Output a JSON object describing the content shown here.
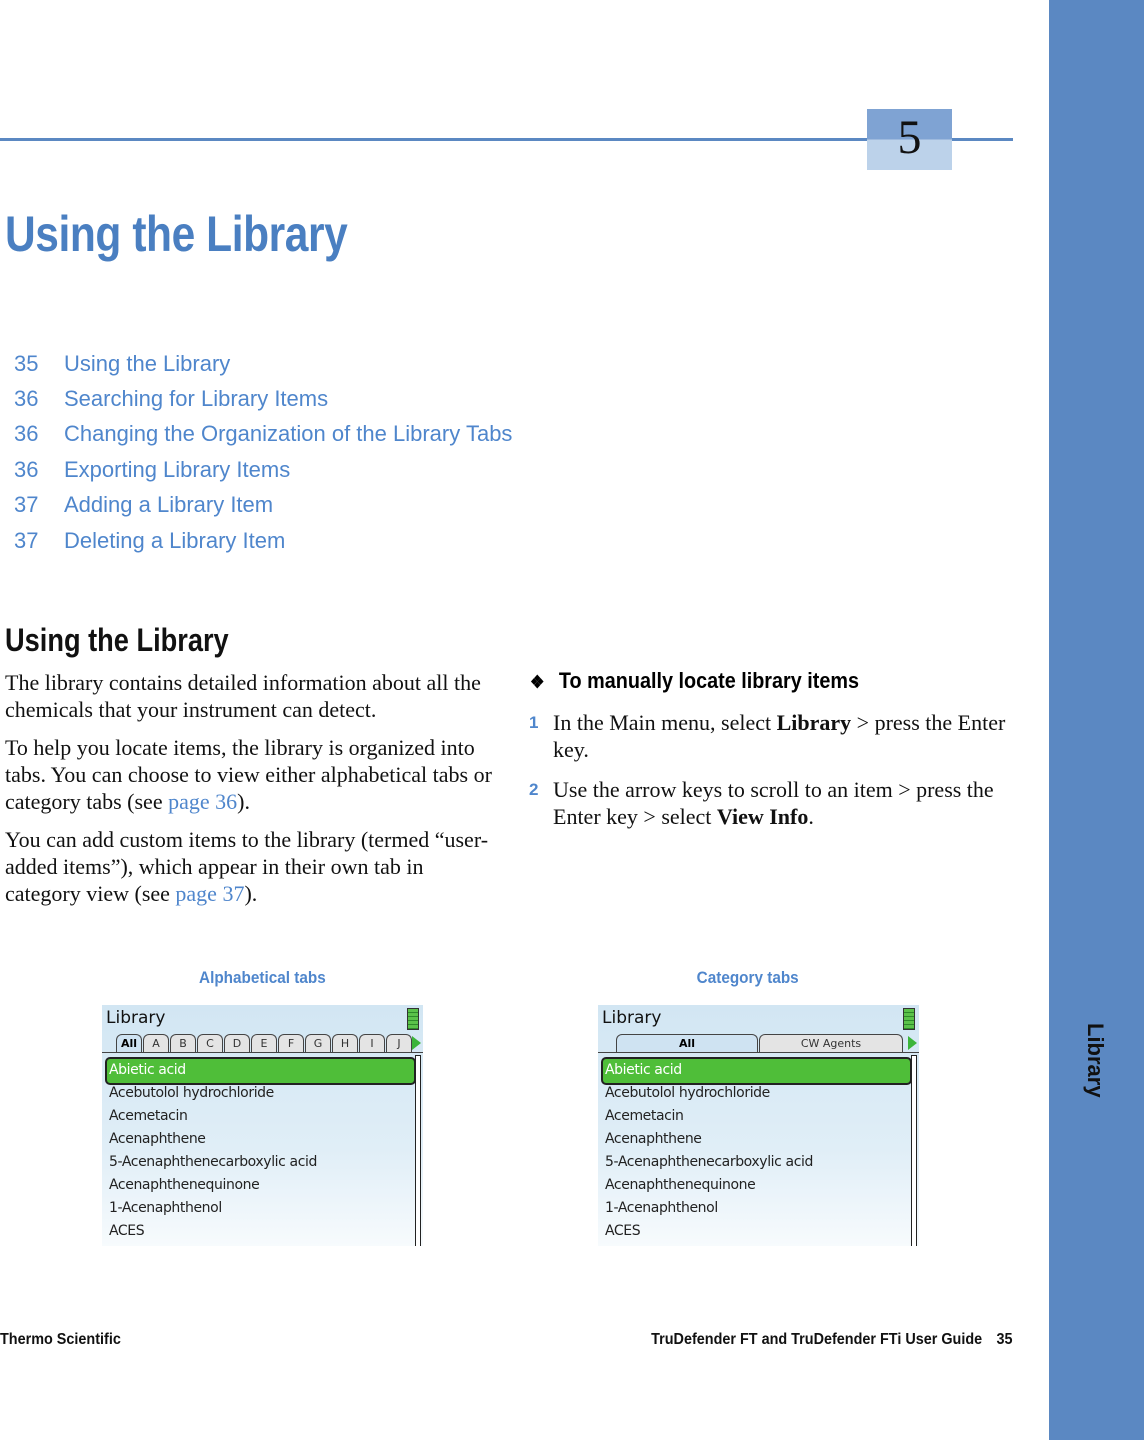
{
  "sidebar": {
    "label": "Library",
    "color": "#5b88c2"
  },
  "chapter": {
    "number": "5",
    "title": "Using the Library"
  },
  "toc": [
    {
      "page": "35",
      "label": "Using the Library"
    },
    {
      "page": "36",
      "label": "Searching for Library Items"
    },
    {
      "page": "36",
      "label": "Changing the Organization of the Library Tabs"
    },
    {
      "page": "36",
      "label": "Exporting Library Items"
    },
    {
      "page": "37",
      "label": "Adding a Library Item"
    },
    {
      "page": "37",
      "label": "Deleting a Library Item"
    }
  ],
  "section": {
    "heading": "Using the Library",
    "p1": "The library contains detailed information about all the chemicals that your instrument can detect.",
    "p2_a": "To help you locate items, the library is organized into tabs. You can choose to view either alphabetical tabs or category tabs (see ",
    "p2_link": "page 36",
    "p2_b": ").",
    "p3_a": "You can add custom items to the library (termed “user-added items”), which appear in their own tab in category view (see ",
    "p3_link": "page 37",
    "p3_b": ")."
  },
  "procedure": {
    "bullet": "❖",
    "title": "To manually locate library items",
    "steps": [
      {
        "n": "1",
        "a": "In the Main menu, select ",
        "b": "Library",
        " c": "",
        "c": " > press the Enter key."
      },
      {
        "n": "2",
        "a": "Use the arrow keys to scroll to an item > press the Enter key > select ",
        "b": "View Info",
        "c": "."
      }
    ]
  },
  "figures": {
    "alpha": {
      "caption": "Alphabetical tabs",
      "title": "Library",
      "tabs": [
        "All",
        "A",
        "B",
        "C",
        "D",
        "E",
        "F",
        "G",
        "H",
        "I",
        "J"
      ]
    },
    "category": {
      "caption": "Category tabs",
      "title": "Library",
      "tabs": [
        "All",
        "CW Agents"
      ]
    },
    "items": [
      "Abietic acid",
      "Acebutolol hydrochloride",
      "Acemetacin",
      "Acenaphthene",
      "5-Acenaphthenecarboxylic acid",
      "Acenaphthenequinone",
      "1-Acenaphthenol",
      "ACES"
    ]
  },
  "footer": {
    "left": "Thermo Scientific",
    "right": "TruDefender FT and TruDefender FTi User Guide",
    "page": "35"
  }
}
